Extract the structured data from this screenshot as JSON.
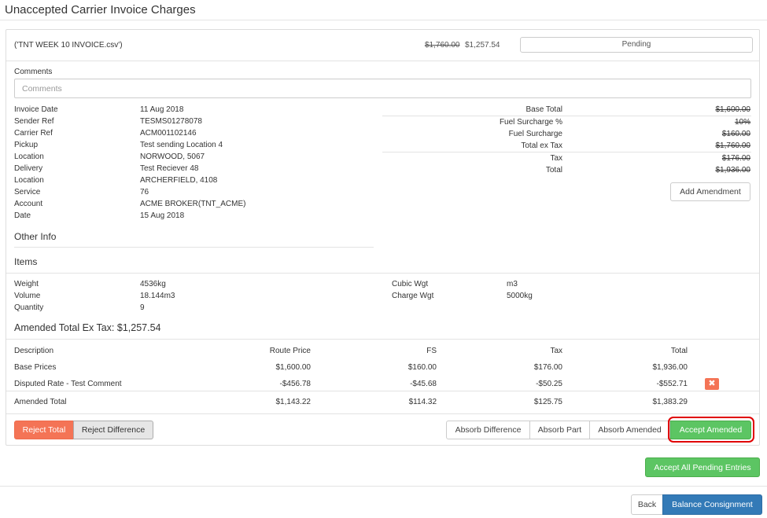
{
  "page": {
    "title": "Unaccepted Carrier Invoice Charges"
  },
  "invoice": {
    "file_name": "('TNT WEEK 10 INVOICE.csv')",
    "original_total": "$1,760.00",
    "amended_total": "$1,257.54",
    "status": "Pending"
  },
  "comments": {
    "label": "Comments",
    "placeholder": "Comments",
    "value": ""
  },
  "details": [
    {
      "label": "Invoice Date",
      "value": "11 Aug 2018"
    },
    {
      "label": "Sender Ref",
      "value": "TESMS01278078"
    },
    {
      "label": "Carrier Ref",
      "value": "ACM001102146"
    },
    {
      "label": "Pickup",
      "value": "Test sending Location 4"
    },
    {
      "label": "Location",
      "value": "NORWOOD, 5067"
    },
    {
      "label": "Delivery",
      "value": "Test Reciever 48"
    },
    {
      "label": "Location",
      "value": "ARCHERFIELD, 4108"
    },
    {
      "label": "Service",
      "value": "76"
    },
    {
      "label": "Account",
      "value": "ACME BROKER(TNT_ACME)"
    },
    {
      "label": "Date",
      "value": "15 Aug 2018"
    }
  ],
  "totals": [
    {
      "label": "Base Total",
      "value": "$1,600.00"
    },
    {
      "label": "Fuel Surcharge %",
      "value": "10%"
    },
    {
      "label": "Fuel Surcharge",
      "value": "$160.00"
    },
    {
      "label": "Total ex Tax",
      "value": "$1,760.00"
    },
    {
      "label": "Tax",
      "value": "$176.00"
    },
    {
      "label": "Total",
      "value": "$1,936.00"
    }
  ],
  "add_amendment_label": "Add Amendment",
  "other_info_heading": "Other Info",
  "items_heading": "Items",
  "measures": {
    "weight_label": "Weight",
    "weight_value": "4536kg",
    "volume_label": "Volume",
    "volume_value": "18.144m3",
    "quantity_label": "Quantity",
    "quantity_value": "9",
    "cubic_label": "Cubic Wgt",
    "cubic_value": "m3",
    "charge_label": "Charge Wgt",
    "charge_value": "5000kg"
  },
  "amended_heading": "Amended Total Ex Tax: $1,257.54",
  "charges_table": {
    "headers": [
      "Description",
      "Route Price",
      "FS",
      "Tax",
      "Total"
    ],
    "rows": [
      [
        "Base Prices",
        "$1,600.00",
        "$160.00",
        "$176.00",
        "$1,936.00"
      ],
      [
        "Disputed Rate - Test Comment",
        "-$456.78",
        "-$45.68",
        "-$50.25",
        "-$552.71"
      ]
    ],
    "footer": [
      "Amended Total",
      "$1,143.22",
      "$114.32",
      "$125.75",
      "$1,383.29"
    ]
  },
  "actions": {
    "reject_total": "Reject Total",
    "reject_difference": "Reject Difference",
    "absorb_difference": "Absorb Difference",
    "absorb_part": "Absorb Part",
    "absorb_amended": "Absorb Amended",
    "accept_amended": "Accept Amended"
  },
  "accept_all_label": "Accept All Pending Entries",
  "footer": {
    "back_label": "Back",
    "balance_label": "Balance Consignment"
  },
  "colors": {
    "reject": "#f47456",
    "accept": "#5cc563",
    "primary": "#337ab7",
    "highlight": "#e00000"
  },
  "icons": {
    "delete_row": "close-icon"
  }
}
